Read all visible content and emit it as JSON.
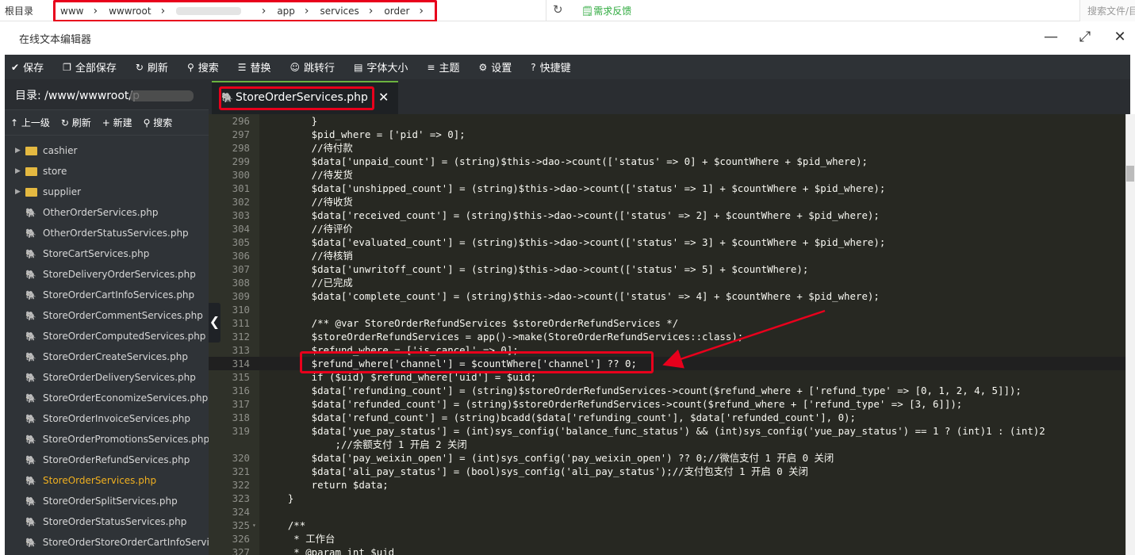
{
  "top": {
    "root_label": "根目录",
    "breadcrumbs": [
      "www",
      "wwwroot",
      "app",
      "services",
      "order"
    ],
    "feedback": "需求反馈",
    "search_file": "搜索文件/目"
  },
  "window": {
    "title": "在线文本编辑器"
  },
  "toolbar": [
    {
      "icon": "save-icon",
      "glyph": "✔",
      "label": "保存"
    },
    {
      "icon": "save-all-icon",
      "glyph": "❐",
      "label": "全部保存"
    },
    {
      "icon": "refresh-icon",
      "glyph": "↻",
      "label": "刷新"
    },
    {
      "icon": "search-icon",
      "glyph": "⚲",
      "label": "搜索"
    },
    {
      "icon": "replace-icon",
      "glyph": "☰",
      "label": "替换"
    },
    {
      "icon": "goto-line-icon",
      "glyph": "☺",
      "label": "跳转行"
    },
    {
      "icon": "font-size-icon",
      "glyph": "▤",
      "label": "字体大小"
    },
    {
      "icon": "theme-icon",
      "glyph": "≡",
      "label": "主题"
    },
    {
      "icon": "settings-icon",
      "glyph": "⚙",
      "label": "设置"
    },
    {
      "icon": "shortcut-icon",
      "glyph": "?",
      "label": "快捷键"
    }
  ],
  "sidebar": {
    "dir_label": "目录: /www/wwwroot/p",
    "tools": [
      {
        "glyph": "↑",
        "label": "上一级"
      },
      {
        "glyph": "↻",
        "label": "刷新"
      },
      {
        "glyph": "+",
        "label": "新建"
      },
      {
        "glyph": "⚲",
        "label": "搜索"
      }
    ],
    "folders": [
      "cashier",
      "store",
      "supplier"
    ],
    "files": [
      "OtherOrderServices.php",
      "OtherOrderStatusServices.php",
      "StoreCartServices.php",
      "StoreDeliveryOrderServices.php",
      "StoreOrderCartInfoServices.php",
      "StoreOrderCommentServices.php",
      "StoreOrderComputedServices.php",
      "StoreOrderCreateServices.php",
      "StoreOrderDeliveryServices.php",
      "StoreOrderEconomizeServices.php",
      "StoreOrderInvoiceServices.php",
      "StoreOrderPromotionsServices.php",
      "StoreOrderRefundServices.php",
      "StoreOrderServices.php",
      "StoreOrderSplitServices.php",
      "StoreOrderStatusServices.php",
      "StoreOrderStoreOrderCartInfoServi"
    ],
    "active_file": "StoreOrderServices.php"
  },
  "tab": {
    "label": "StoreOrderServices.php"
  },
  "code": [
    {
      "n": "296",
      "t": "        }"
    },
    {
      "n": "297",
      "t": "        $pid_where = ['pid' => 0];"
    },
    {
      "n": "298",
      "t": "        //待付款"
    },
    {
      "n": "299",
      "t": "        $data['unpaid_count'] = (string)$this->dao->count(['status' => 0] + $countWhere + $pid_where);"
    },
    {
      "n": "300",
      "t": "        //待发货"
    },
    {
      "n": "301",
      "t": "        $data['unshipped_count'] = (string)$this->dao->count(['status' => 1] + $countWhere + $pid_where);"
    },
    {
      "n": "302",
      "t": "        //待收货"
    },
    {
      "n": "303",
      "t": "        $data['received_count'] = (string)$this->dao->count(['status' => 2] + $countWhere + $pid_where);"
    },
    {
      "n": "304",
      "t": "        //待评价"
    },
    {
      "n": "305",
      "t": "        $data['evaluated_count'] = (string)$this->dao->count(['status' => 3] + $countWhere + $pid_where);"
    },
    {
      "n": "306",
      "t": "        //待核销"
    },
    {
      "n": "307",
      "t": "        $data['unwritoff_count'] = (string)$this->dao->count(['status' => 5] + $countWhere);"
    },
    {
      "n": "308",
      "t": "        //已完成"
    },
    {
      "n": "309",
      "t": "        $data['complete_count'] = (string)$this->dao->count(['status' => 4] + $countWhere + $pid_where);"
    },
    {
      "n": "310",
      "t": ""
    },
    {
      "n": "311",
      "t": "        /** @var StoreOrderRefundServices $storeOrderRefundServices */"
    },
    {
      "n": "312",
      "t": "        $storeOrderRefundServices = app()->make(StoreOrderRefundServices::class);"
    },
    {
      "n": "313",
      "t": "        $refund_where = ['is_cancel' => 0];"
    },
    {
      "n": "314",
      "t": "        $refund_where['channel'] = $countWhere['channel'] ?? 0;"
    },
    {
      "n": "315",
      "t": "        if ($uid) $refund_where['uid'] = $uid;"
    },
    {
      "n": "316",
      "t": "        $data['refunding_count'] = (string)$storeOrderRefundServices->count($refund_where + ['refund_type' => [0, 1, 2, 4, 5]]);"
    },
    {
      "n": "317",
      "t": "        $data['refunded_count'] = (string)$storeOrderRefundServices->count($refund_where + ['refund_type' => [3, 6]]);"
    },
    {
      "n": "318",
      "t": "        $data['refund_count'] = (string)bcadd($data['refunding_count'], $data['refunded_count'], 0);"
    },
    {
      "n": "319",
      "t": "        $data['yue_pay_status'] = (int)sys_config('balance_func_status') && (int)sys_config('yue_pay_status') == 1 ? (int)1 : (int)2"
    },
    {
      "n": "",
      "t": "            ;//余额支付 1 开启 2 关闭"
    },
    {
      "n": "320",
      "t": "        $data['pay_weixin_open'] = (int)sys_config('pay_weixin_open') ?? 0;//微信支付 1 开启 0 关闭"
    },
    {
      "n": "321",
      "t": "        $data['ali_pay_status'] = (bool)sys_config('ali_pay_status');//支付包支付 1 开启 0 关闭"
    },
    {
      "n": "322",
      "t": "        return $data;"
    },
    {
      "n": "323",
      "t": "    }"
    },
    {
      "n": "324",
      "t": ""
    },
    {
      "n": "325",
      "t": "    /**"
    },
    {
      "n": "326",
      "t": "     * 工作台"
    },
    {
      "n": "327",
      "t": "     * @param int $uid"
    }
  ]
}
